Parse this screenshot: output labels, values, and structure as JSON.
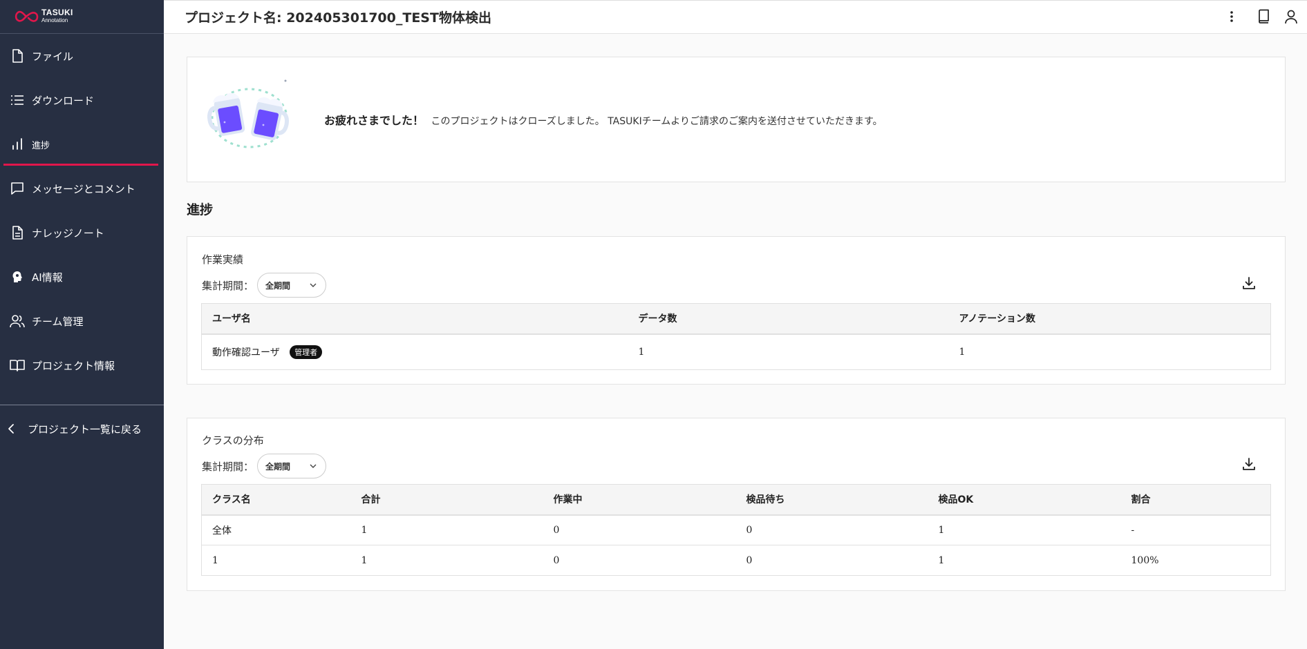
{
  "brand": {
    "name_line1": "TASUKI",
    "name_line2": "Annotation",
    "accent": "#e1164b",
    "sidebar_bg": "#272f42"
  },
  "sidebar": {
    "items": [
      {
        "label": "ファイル",
        "icon": "file-icon"
      },
      {
        "label": "ダウンロード",
        "icon": "list-icon"
      },
      {
        "label": "進捗",
        "icon": "bar-chart-icon",
        "active": true
      },
      {
        "label": "メッセージとコメント",
        "icon": "message-icon"
      },
      {
        "label": "ナレッジノート",
        "icon": "document-icon"
      },
      {
        "label": "AI情報",
        "icon": "ai-head-icon"
      },
      {
        "label": "チーム管理",
        "icon": "team-icon"
      },
      {
        "label": "プロジェクト情報",
        "icon": "book-open-icon"
      }
    ],
    "back_label": "プロジェクト一覧に戻る"
  },
  "header": {
    "title": "プロジェクト名: 202405301700_TEST物体検出"
  },
  "banner": {
    "bold": "お疲れさまでした！",
    "text": "このプロジェクトはクローズしました。 TASUKIチームよりご請求のご案内を送付させていただきます。"
  },
  "section_title": "進捗",
  "performance": {
    "title": "作業実績",
    "period_label": "集計期間：",
    "period_value": "全期間",
    "columns": [
      "ユーザ名",
      "データ数",
      "アノテーション数"
    ],
    "rows": [
      {
        "user": "動作確認ユーザ",
        "badge": "管理者",
        "data": "1",
        "annotations": "1"
      }
    ]
  },
  "distribution": {
    "title": "クラスの分布",
    "period_label": "集計期間：",
    "period_value": "全期間",
    "columns": [
      "クラス名",
      "合計",
      "作業中",
      "検品待ち",
      "検品OK",
      "割合"
    ],
    "rows": [
      [
        "全体",
        "1",
        "0",
        "0",
        "1",
        "-"
      ],
      [
        "1",
        "1",
        "0",
        "0",
        "1",
        "100%"
      ]
    ]
  }
}
